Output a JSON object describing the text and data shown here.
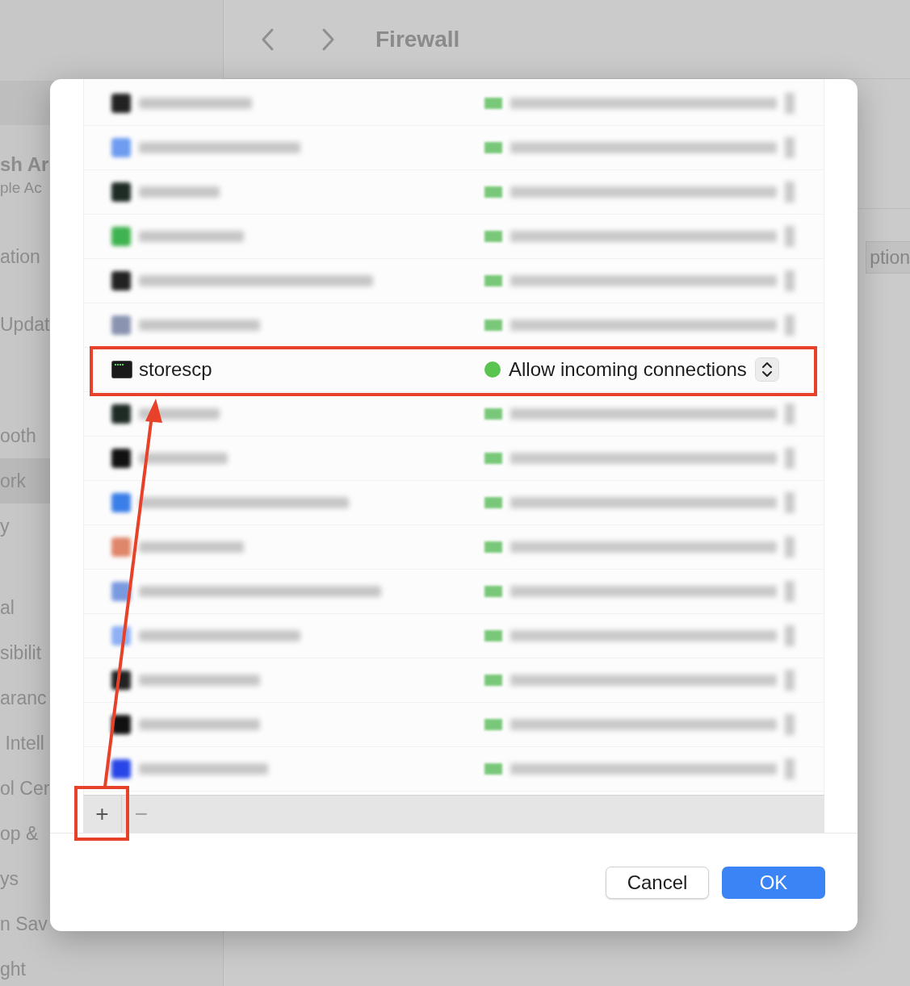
{
  "toolbar": {
    "title": "Firewall"
  },
  "sidebar": {
    "account": {
      "name": "sh Ar",
      "subtitle": "ple Ac"
    },
    "groups": [
      {
        "items": [
          {
            "label": "ation",
            "selected": false
          }
        ]
      },
      {
        "items": [
          {
            "label": "Updat",
            "selected": false
          }
        ]
      },
      {
        "items": [
          {
            "label": "ooth",
            "selected": false
          },
          {
            "label": "ork",
            "selected": true
          },
          {
            "label": "y",
            "selected": false
          }
        ]
      },
      {
        "items": [
          {
            "label": "al",
            "selected": false
          },
          {
            "label": "sibilit",
            "selected": false
          },
          {
            "label": "aranc",
            "selected": false
          },
          {
            "label": " Intell",
            "selected": false
          },
          {
            "label": "ol Cer",
            "selected": false
          },
          {
            "label": "op &",
            "selected": false
          },
          {
            "label": "ys",
            "selected": false
          },
          {
            "label": "n Sav",
            "selected": false
          },
          {
            "label": "ght",
            "selected": false
          }
        ]
      }
    ]
  },
  "main": {
    "button": "ption"
  },
  "sheet": {
    "apps": [
      {
        "kind": "blurred",
        "color": "#222222"
      },
      {
        "kind": "blurred",
        "color": "#6d9cf0"
      },
      {
        "kind": "blurred",
        "color": "#1e2a24"
      },
      {
        "kind": "blurred",
        "color": "#3fb34f"
      },
      {
        "kind": "blurred",
        "color": "#222222"
      },
      {
        "kind": "blurred",
        "color": "#8a94b0"
      },
      {
        "kind": "app",
        "name": "storescp",
        "status": "Allow incoming connections",
        "color": "#5ac451"
      },
      {
        "kind": "blurred",
        "color": "#1e2a24"
      },
      {
        "kind": "blurred",
        "color": "#111111"
      },
      {
        "kind": "blurred",
        "color": "#3a7ee8"
      },
      {
        "kind": "blurred",
        "color": "#e0866a"
      },
      {
        "kind": "blurred",
        "color": "#7a9ae0"
      },
      {
        "kind": "blurred",
        "color": "#8fb0f5"
      },
      {
        "kind": "blurred",
        "color": "#222222"
      },
      {
        "kind": "blurred",
        "color": "#111111"
      },
      {
        "kind": "blurred",
        "color": "#2846e8"
      }
    ],
    "list_buttons": [
      "+",
      "−"
    ],
    "buttons": [
      {
        "label": "Cancel",
        "kind": "secondary"
      },
      {
        "label": "OK",
        "kind": "default"
      }
    ]
  }
}
